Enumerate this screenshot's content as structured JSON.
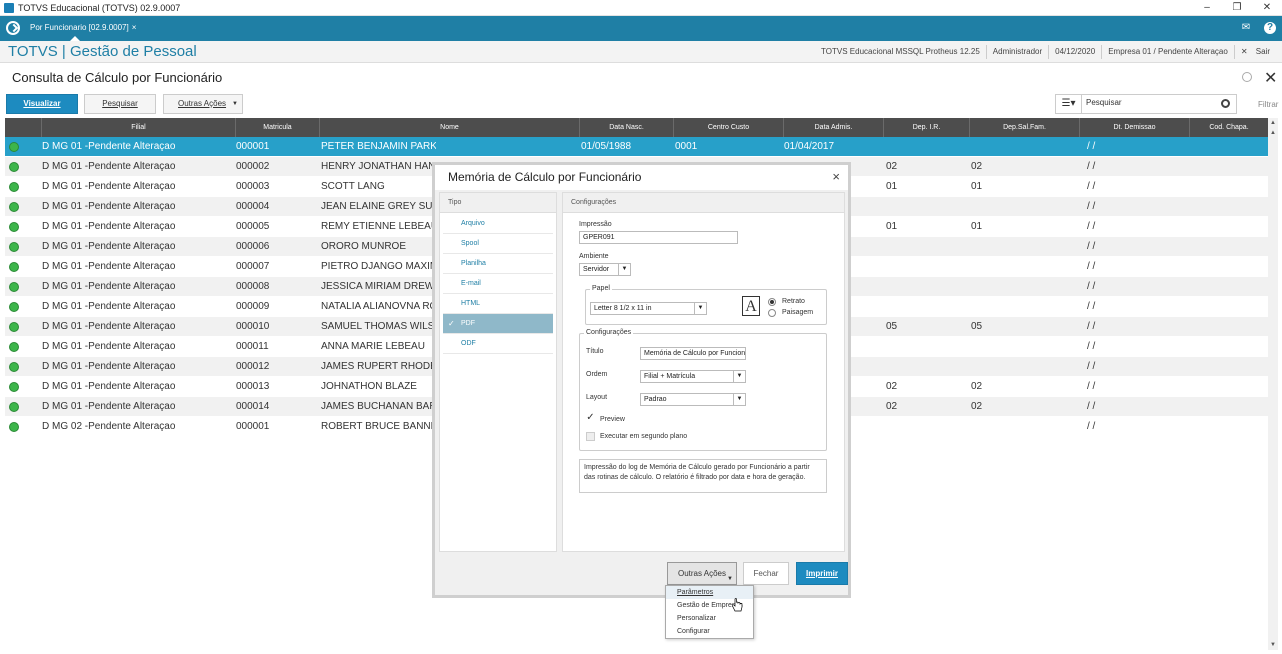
{
  "window": {
    "title": "TOTVS Educacional (TOTVS) 02.9.0007",
    "controls": [
      "–",
      "❐",
      "✕"
    ]
  },
  "tab": {
    "label": "Por Funcionario [02.9.0007]",
    "close": "×"
  },
  "header": {
    "brand": "TOTVS | Gestão de Pessoal",
    "env": "TOTVS Educacional MSSQL Protheus 12.25",
    "user": "Administrador",
    "date": "04/12/2020",
    "company": "Empresa 01 / Pendente Alteraçao",
    "exit": "Sair"
  },
  "page": {
    "title": "Consulta de Cálculo por Funcionário"
  },
  "toolbar": {
    "view": "Visualizar",
    "search": "Pesquisar",
    "more": "Outras Ações",
    "search_placeholder": "Pesquisar",
    "filter": "Filtrar"
  },
  "grid": {
    "columns": [
      "Filial",
      "Matricula",
      "Nome",
      "Data Nasc.",
      "Centro Custo",
      "Data Admis.",
      "Dep. I.R.",
      "Dep.Sal.Fam.",
      "Dt. Demissao",
      "Cod. Chapa."
    ],
    "rows": [
      {
        "filial": "D MG 01 -Pendente Alteraçao",
        "mat": "000001",
        "nome": "PETER BENJAMIN PARKER",
        "nasc": "01/05/1988",
        "cc": "0001",
        "admis": "01/04/2017",
        "dir": "",
        "dsf": "",
        "dem": "/ /"
      },
      {
        "filial": "D MG 01 -Pendente Alteraçao",
        "mat": "000002",
        "nome": "HENRY JONATHAN HANK",
        "nasc": "",
        "cc": "",
        "admis": "",
        "dir": "02",
        "dsf": "02",
        "dem": "/ /"
      },
      {
        "filial": "D MG 01 -Pendente Alteraçao",
        "mat": "000003",
        "nome": "SCOTT LANG",
        "nasc": "",
        "cc": "",
        "admis": "",
        "dir": "01",
        "dsf": "01",
        "dem": "/ /"
      },
      {
        "filial": "D MG 01 -Pendente Alteraçao",
        "mat": "000004",
        "nome": "JEAN ELAINE GREY SUMM",
        "nasc": "",
        "cc": "",
        "admis": "",
        "dir": "",
        "dsf": "",
        "dem": "/ /"
      },
      {
        "filial": "D MG 01 -Pendente Alteraçao",
        "mat": "000005",
        "nome": "REMY ETIENNE LEBEAU",
        "nasc": "",
        "cc": "",
        "admis": "",
        "dir": "01",
        "dsf": "01",
        "dem": "/ /"
      },
      {
        "filial": "D MG 01 -Pendente Alteraçao",
        "mat": "000006",
        "nome": "ORORO MUNROE",
        "nasc": "",
        "cc": "",
        "admis": "",
        "dir": "",
        "dsf": "",
        "dem": "/ /"
      },
      {
        "filial": "D MG 01 -Pendente Alteraçao",
        "mat": "000007",
        "nome": "PIETRO DJANGO MAXIMO",
        "nasc": "",
        "cc": "",
        "admis": "",
        "dir": "",
        "dsf": "",
        "dem": "/ /"
      },
      {
        "filial": "D MG 01 -Pendente Alteraçao",
        "mat": "000008",
        "nome": "JESSICA MIRIAM DREW",
        "nasc": "",
        "cc": "",
        "admis": "",
        "dir": "",
        "dsf": "",
        "dem": "/ /"
      },
      {
        "filial": "D MG 01 -Pendente Alteraçao",
        "mat": "000009",
        "nome": "NATALIA ALIANOVNA ROM",
        "nasc": "",
        "cc": "",
        "admis": "",
        "dir": "",
        "dsf": "",
        "dem": "/ /"
      },
      {
        "filial": "D MG 01 -Pendente Alteraçao",
        "mat": "000010",
        "nome": "SAMUEL THOMAS WILSO",
        "nasc": "",
        "cc": "",
        "admis": "",
        "dir": "05",
        "dsf": "05",
        "dem": "/ /"
      },
      {
        "filial": "D MG 01 -Pendente Alteraçao",
        "mat": "000011",
        "nome": "ANNA MARIE LEBEAU",
        "nasc": "",
        "cc": "",
        "admis": "",
        "dir": "",
        "dsf": "",
        "dem": "/ /"
      },
      {
        "filial": "D MG 01 -Pendente Alteraçao",
        "mat": "000012",
        "nome": "JAMES RUPERT RHODES",
        "nasc": "",
        "cc": "",
        "admis": "",
        "dir": "",
        "dsf": "",
        "dem": "/ /"
      },
      {
        "filial": "D MG 01 -Pendente Alteraçao",
        "mat": "000013",
        "nome": "JOHNATHON BLAZE",
        "nasc": "",
        "cc": "",
        "admis": "",
        "dir": "02",
        "dsf": "02",
        "dem": "/ /"
      },
      {
        "filial": "D MG 01 -Pendente Alteraçao",
        "mat": "000014",
        "nome": "JAMES BUCHANAN BARNE",
        "nasc": "",
        "cc": "",
        "admis": "",
        "dir": "02",
        "dsf": "02",
        "dem": "/ /"
      },
      {
        "filial": "D MG 02 -Pendente Alteraçao",
        "mat": "000001",
        "nome": "ROBERT BRUCE BANNER",
        "nasc": "",
        "cc": "",
        "admis": "",
        "dir": "",
        "dsf": "",
        "dem": "/ /"
      }
    ]
  },
  "modal": {
    "title": "Memória de Cálculo por Funcionário",
    "close": "×",
    "tipo_header": "Tipo",
    "tipos": [
      "Arquivo",
      "Spool",
      "Planilha",
      "E-mail",
      "HTML",
      "PDF",
      "ODF"
    ],
    "selected_tipo": "PDF",
    "config_header": "Configurações",
    "impressao_label": "Impressão",
    "impressao_value": "GPER091",
    "ambiente_label": "Ambiente",
    "ambiente_value": "Servidor",
    "papel_legend": "Papel",
    "papel_value": "Letter 8 1/2 x 11 in",
    "font_glyph": "A",
    "retrato": "Retrato",
    "paisagem": "Paisagem",
    "config_legend": "Configurações",
    "titulo_label": "Título",
    "titulo_value": "Memória de Cálculo por Funcionár",
    "ordem_label": "Ordem",
    "ordem_value": "Filial + Matrícula",
    "layout_label": "Layout",
    "layout_value": "Padrao",
    "preview_label": "Preview",
    "background_label": "Executar em segundo plano",
    "description": "Impressão do log de Memória de Cálculo gerado por Funcionário a partir das rotinas de cálculo. O relatório é filtrado por data e hora de geração.",
    "btn_more": "Outras Ações",
    "btn_close": "Fechar",
    "btn_print": "Imprimir",
    "menu": [
      "Parâmetros",
      "Gestão de Empresas",
      "Personalizar",
      "Configurar"
    ]
  },
  "colors": {
    "accent": "#1f7fa5",
    "selected_row": "#27a0c9",
    "status_ok": "#3db54a",
    "header_grid": "#4d4d4d"
  }
}
